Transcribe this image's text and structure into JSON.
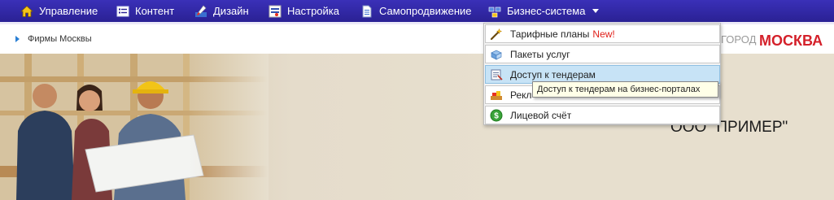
{
  "nav": {
    "items": [
      {
        "label": "Управление",
        "icon": "home-icon"
      },
      {
        "label": "Контент",
        "icon": "content-list-icon"
      },
      {
        "label": "Дизайн",
        "icon": "design-brush-icon"
      },
      {
        "label": "Настройка",
        "icon": "settings-icon"
      },
      {
        "label": "Самопродвижение",
        "icon": "document-icon"
      },
      {
        "label": "Бизнес-система",
        "icon": "business-system-icon"
      }
    ]
  },
  "breadcrumb": {
    "label": "Фирмы Москвы"
  },
  "header": {
    "city_label": "ГОРОД",
    "city_name": "МОСКВА"
  },
  "banner": {
    "company_name": "ООО \"ПРИМЕР\""
  },
  "dropdown": {
    "items": [
      {
        "label": "Тарифные планы",
        "badge": "New!",
        "icon": "magic-wand-icon"
      },
      {
        "label": "Пакеты услуг",
        "icon": "package-icon"
      },
      {
        "label": "Доступ к тендерам",
        "icon": "tender-icon"
      },
      {
        "label": "Рекл",
        "icon": "advertising-icon"
      },
      {
        "label": "Лицевой счёт",
        "icon": "dollar-coin-icon"
      }
    ],
    "tooltip": "Доступ к тендерам на бизнес-порталах"
  },
  "colors": {
    "nav_bg": "#2a2194",
    "accent_red": "#d4202a",
    "link_blue": "#2a7fd4",
    "hover_blue": "#c7e3f6"
  }
}
